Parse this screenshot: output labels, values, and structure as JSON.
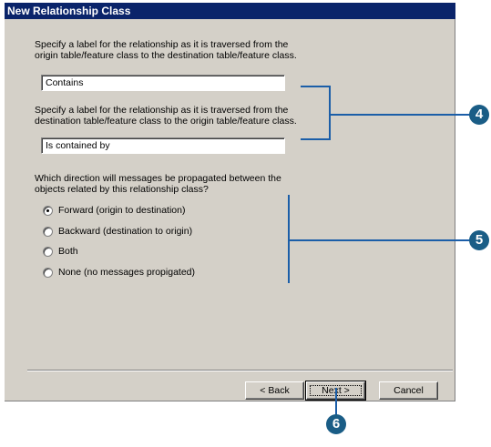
{
  "window": {
    "title": "New Relationship Class"
  },
  "forward_label": {
    "prompt_line1": "Specify a label for the relationship as it is traversed from the",
    "prompt_line2": "origin table/feature class to the destination table/feature class.",
    "value": "Contains"
  },
  "backward_label": {
    "prompt_line1": "Specify a label for the relationship as it is traversed from the",
    "prompt_line2": "destination table/feature class to the origin table/feature class.",
    "value": "Is contained by"
  },
  "messages": {
    "prompt_line1": "Which direction will messages be propagated between the",
    "prompt_line2": "objects related by this relationship class?",
    "options": [
      {
        "label": "Forward (origin to destination)",
        "checked": true
      },
      {
        "label": "Backward (destination to origin)",
        "checked": false
      },
      {
        "label": "Both",
        "checked": false
      },
      {
        "label": "None (no messages propigated)",
        "checked": false
      }
    ]
  },
  "buttons": {
    "back": "< Back",
    "next": "Next >",
    "cancel": "Cancel"
  },
  "callouts": {
    "step4": "4",
    "step5": "5",
    "step6": "6"
  },
  "colors": {
    "titlebar": "#0a246a",
    "dialog_bg": "#d4d0c8",
    "callout": "#1a5d86",
    "bracket": "#1b5ea8"
  }
}
